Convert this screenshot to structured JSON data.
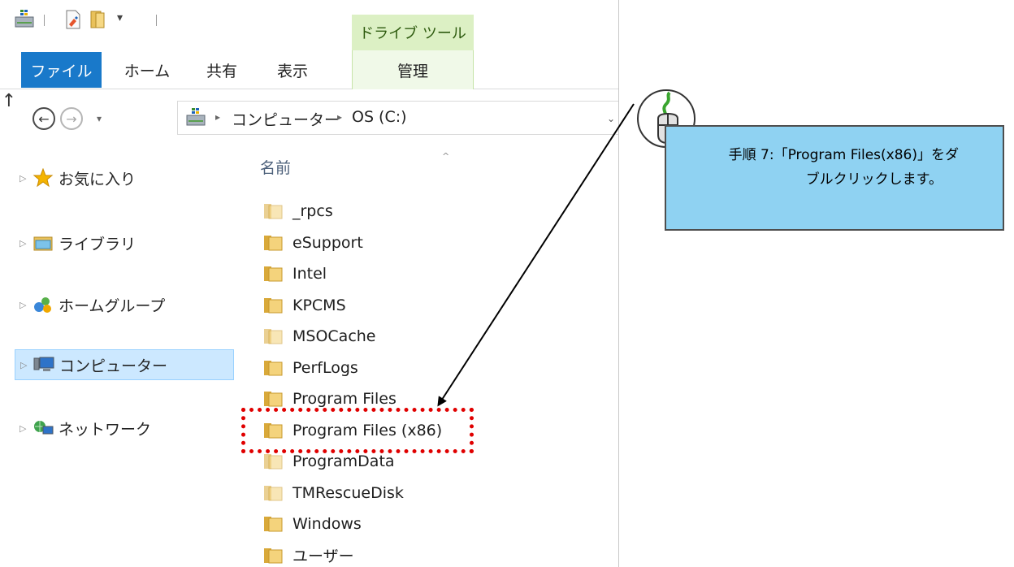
{
  "ribbon": {
    "context_tab_group": "ドライブ ツール",
    "tabs": [
      {
        "label": "ファイル",
        "active": true
      },
      {
        "label": "ホーム"
      },
      {
        "label": "共有"
      },
      {
        "label": "表示"
      },
      {
        "label": "管理"
      }
    ]
  },
  "quick_access": {
    "icons": [
      "drive-icon",
      "properties-icon",
      "new-folder-icon",
      "customize-dropdown-icon"
    ],
    "dropdown_glyph": "▾"
  },
  "navigation": {
    "back_glyph": "←",
    "forward_glyph": "→",
    "recent_glyph": "▾",
    "up_glyph": "↑"
  },
  "address_bar": {
    "breadcrumbs": [
      "コンピューター",
      "OS (C:)"
    ],
    "separator": "▸",
    "dropdown_glyph": "⌄"
  },
  "nav_pane": {
    "expander_glyph": "▷",
    "items": [
      {
        "label": "お気に入り",
        "icon": "star-icon"
      },
      {
        "label": "ライブラリ",
        "icon": "library-icon"
      },
      {
        "label": "ホームグループ",
        "icon": "homegroup-icon"
      },
      {
        "label": "コンピューター",
        "icon": "computer-icon",
        "selected": true
      },
      {
        "label": "ネットワーク",
        "icon": "network-icon"
      }
    ]
  },
  "file_list": {
    "column_header": "名前",
    "sort_glyph": "^",
    "items": [
      {
        "name": "_rpcs",
        "hidden": true
      },
      {
        "name": "eSupport"
      },
      {
        "name": "Intel"
      },
      {
        "name": "KPCMS"
      },
      {
        "name": "MSOCache",
        "hidden": true
      },
      {
        "name": "PerfLogs"
      },
      {
        "name": "Program Files"
      },
      {
        "name": "Program Files (x86)",
        "highlighted": true
      },
      {
        "name": "ProgramData",
        "hidden": true
      },
      {
        "name": "TMRescueDisk",
        "hidden": true
      },
      {
        "name": "Windows"
      },
      {
        "name": "ユーザー"
      }
    ]
  },
  "callout": {
    "line1": "手順 7:「Program Files(x86)」をダ",
    "line2": "ブルクリックします。",
    "icon": "mouse-icon",
    "colors": {
      "fill": "#8fd2f2",
      "border": "#4e4e4e",
      "highlight": "#e00000",
      "cable": "#3aa52f"
    }
  }
}
